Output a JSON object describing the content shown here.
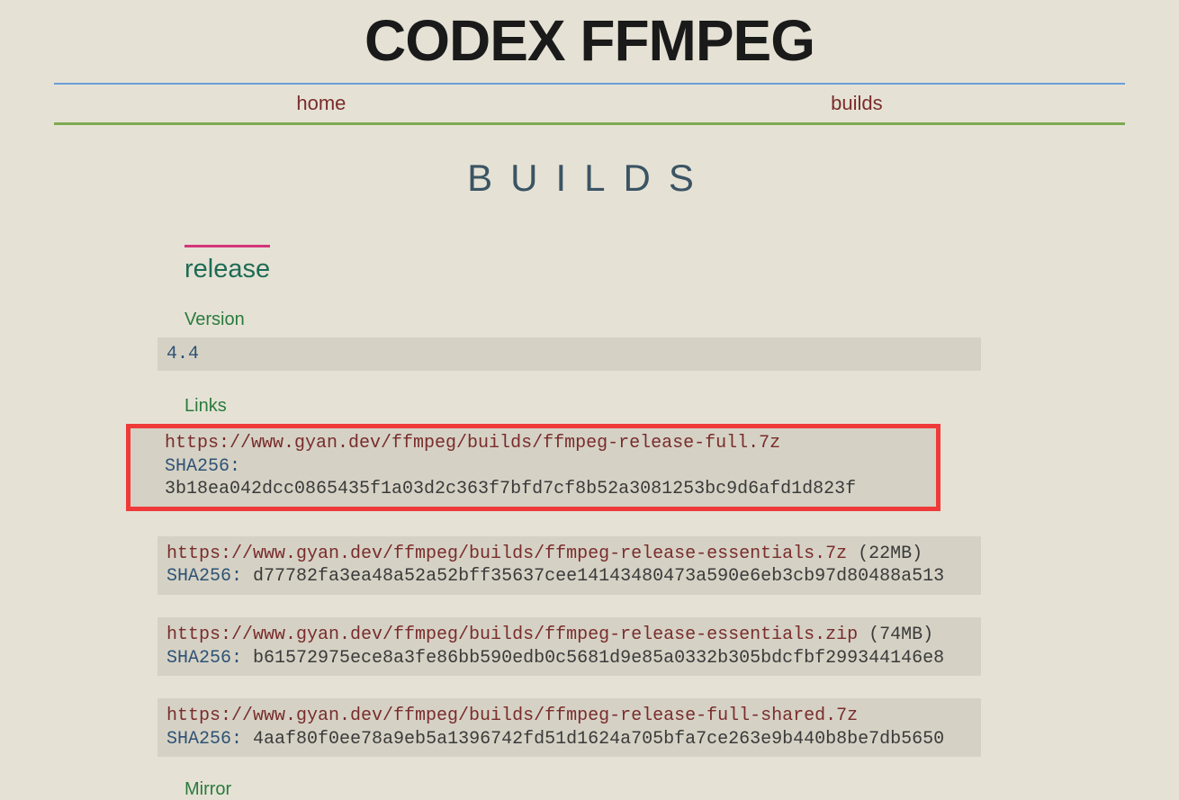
{
  "site_title": "CODEX FFMPEG",
  "nav": {
    "home": "home",
    "builds": "builds"
  },
  "page_heading": "BUILDS",
  "section": {
    "title": "release",
    "version_label": "Version",
    "version_value": "4.4",
    "links_label": "Links",
    "mirror_label": "Mirror",
    "links": [
      {
        "url": "https://www.gyan.dev/ffmpeg/builds/ffmpeg-release-full.7z",
        "size": "",
        "sha_label": "SHA256:",
        "sha_value": "3b18ea042dcc0865435f1a03d2c363f7bfd7cf8b52a3081253bc9d6afd1d823f",
        "highlighted": true
      },
      {
        "url": "https://www.gyan.dev/ffmpeg/builds/ffmpeg-release-essentials.7z",
        "size": " (22MB)",
        "sha_label": "SHA256:",
        "sha_value": "d77782fa3ea48a52a52bff35637cee14143480473a590e6eb3cb97d80488a513",
        "highlighted": false
      },
      {
        "url": "https://www.gyan.dev/ffmpeg/builds/ffmpeg-release-essentials.zip",
        "size": " (74MB)",
        "sha_label": "SHA256:",
        "sha_value": "b61572975ece8a3fe86bb590edb0c5681d9e85a0332b305bdcfbf299344146e8",
        "highlighted": false
      },
      {
        "url": "https://www.gyan.dev/ffmpeg/builds/ffmpeg-release-full-shared.7z",
        "size": "",
        "sha_label": "SHA256:",
        "sha_value": "4aaf80f0ee78a9eb5a1396742fd51d1624a705bfa7ce263e9b440b8be7db5650",
        "highlighted": false
      }
    ]
  }
}
